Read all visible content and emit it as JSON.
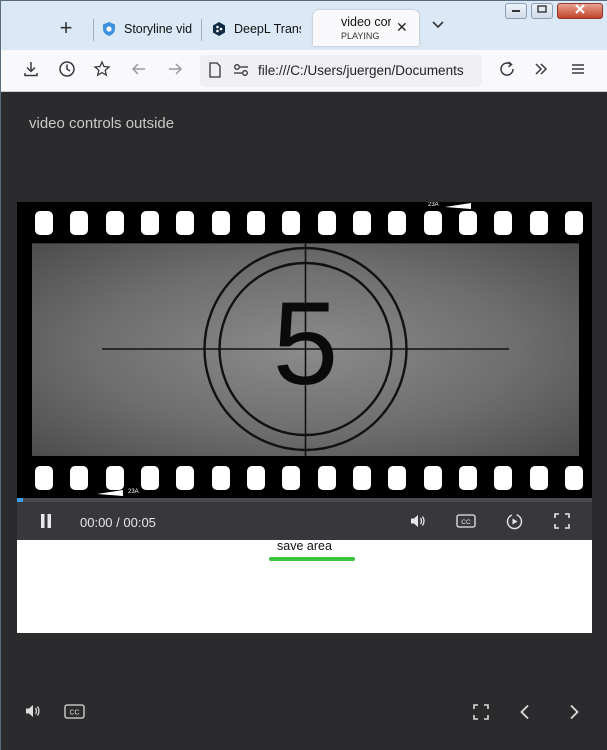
{
  "browser": {
    "tabs": [
      {
        "title": "Storyline vid",
        "favicon": "shield-favicon",
        "color": "#3d8fe0"
      },
      {
        "title": "DeepL Transl",
        "favicon": "deepl-favicon",
        "color": "#0f2b46"
      }
    ],
    "active_tab": {
      "title": "video con",
      "subtitle": "PLAYING"
    },
    "new_tab_symbol": "+",
    "dropdown_symbol": "⌄",
    "close_symbol": "✕",
    "url": "file:///C:/Users/juergen/Documents"
  },
  "page": {
    "heading": "video controls outside",
    "video": {
      "countdown_digit": "5",
      "edge_code": "23A",
      "progress": 0.01,
      "time": "00:00 / 00:05",
      "cc_label": "CC"
    },
    "save_area": {
      "label": "save area",
      "underline_color": "#3cc43c"
    },
    "bottom_controls": {
      "cc_label": "CC"
    }
  },
  "colors": {
    "accent": "#3d9be9",
    "page_bg": "#2b2b2e",
    "controlbar_bg": "#38383c"
  }
}
